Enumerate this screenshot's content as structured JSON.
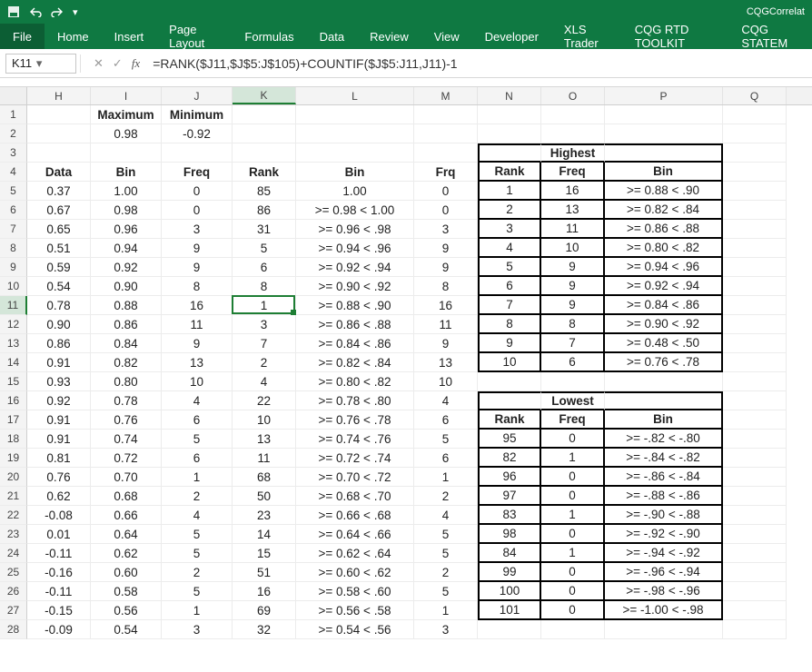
{
  "titlebar": {
    "doc_name": "CQGCorrelat"
  },
  "ribbon": {
    "tabs": [
      "File",
      "Home",
      "Insert",
      "Page Layout",
      "Formulas",
      "Data",
      "Review",
      "View",
      "Developer",
      "XLS Trader",
      "CQG RTD TOOLKIT",
      "CQG STATEM"
    ]
  },
  "namebox": "K11",
  "formula": "=RANK($J11,$J$5:J$105)+COUNTIF($J$5:J11,J11)-1",
  "columns": [
    "H",
    "I",
    "J",
    "K",
    "L",
    "M",
    "N",
    "O",
    "P",
    "Q"
  ],
  "headers": {
    "I1": "Maximum",
    "J1": "Minimum",
    "I2": "0.98",
    "J2": "-0.92",
    "H4": "Data",
    "I4": "Bin",
    "J4": "Freq",
    "K4": "Rank",
    "L4": "Bin",
    "M4": "Frq",
    "highest_title": "Highest",
    "N4": "Rank",
    "O4": "Freq",
    "P4": "Bin",
    "lowest_title": "Lowest",
    "N17": "Rank",
    "O17": "Freq",
    "P17": "Bin"
  },
  "main_rows": [
    {
      "r": 5,
      "H": "0.37",
      "I": "1.00",
      "J": "0",
      "K": "85",
      "L": "1.00",
      "M": "0"
    },
    {
      "r": 6,
      "H": "0.67",
      "I": "0.98",
      "J": "0",
      "K": "86",
      "L": ">= 0.98 < 1.00",
      "M": "0"
    },
    {
      "r": 7,
      "H": "0.65",
      "I": "0.96",
      "J": "3",
      "K": "31",
      "L": ">= 0.96 < .98",
      "M": "3"
    },
    {
      "r": 8,
      "H": "0.51",
      "I": "0.94",
      "J": "9",
      "K": "5",
      "L": ">= 0.94 < .96",
      "M": "9"
    },
    {
      "r": 9,
      "H": "0.59",
      "I": "0.92",
      "J": "9",
      "K": "6",
      "L": ">= 0.92 < .94",
      "M": "9"
    },
    {
      "r": 10,
      "H": "0.54",
      "I": "0.90",
      "J": "8",
      "K": "8",
      "L": ">= 0.90 < .92",
      "M": "8"
    },
    {
      "r": 11,
      "H": "0.78",
      "I": "0.88",
      "J": "16",
      "K": "1",
      "L": ">= 0.88 < .90",
      "M": "16"
    },
    {
      "r": 12,
      "H": "0.90",
      "I": "0.86",
      "J": "11",
      "K": "3",
      "L": ">= 0.86 < .88",
      "M": "11"
    },
    {
      "r": 13,
      "H": "0.86",
      "I": "0.84",
      "J": "9",
      "K": "7",
      "L": ">= 0.84 < .86",
      "M": "9"
    },
    {
      "r": 14,
      "H": "0.91",
      "I": "0.82",
      "J": "13",
      "K": "2",
      "L": ">= 0.82 < .84",
      "M": "13"
    },
    {
      "r": 15,
      "H": "0.93",
      "I": "0.80",
      "J": "10",
      "K": "4",
      "L": ">= 0.80 < .82",
      "M": "10"
    },
    {
      "r": 16,
      "H": "0.92",
      "I": "0.78",
      "J": "4",
      "K": "22",
      "L": ">= 0.78 < .80",
      "M": "4"
    },
    {
      "r": 17,
      "H": "0.91",
      "I": "0.76",
      "J": "6",
      "K": "10",
      "L": ">= 0.76 < .78",
      "M": "6"
    },
    {
      "r": 18,
      "H": "0.91",
      "I": "0.74",
      "J": "5",
      "K": "13",
      "L": ">= 0.74 < .76",
      "M": "5"
    },
    {
      "r": 19,
      "H": "0.81",
      "I": "0.72",
      "J": "6",
      "K": "11",
      "L": ">= 0.72 < .74",
      "M": "6"
    },
    {
      "r": 20,
      "H": "0.76",
      "I": "0.70",
      "J": "1",
      "K": "68",
      "L": ">= 0.70 < .72",
      "M": "1"
    },
    {
      "r": 21,
      "H": "0.62",
      "I": "0.68",
      "J": "2",
      "K": "50",
      "L": ">= 0.68 < .70",
      "M": "2"
    },
    {
      "r": 22,
      "H": "-0.08",
      "I": "0.66",
      "J": "4",
      "K": "23",
      "L": ">= 0.66 < .68",
      "M": "4"
    },
    {
      "r": 23,
      "H": "0.01",
      "I": "0.64",
      "J": "5",
      "K": "14",
      "L": ">= 0.64 < .66",
      "M": "5"
    },
    {
      "r": 24,
      "H": "-0.11",
      "I": "0.62",
      "J": "5",
      "K": "15",
      "L": ">= 0.62 < .64",
      "M": "5"
    },
    {
      "r": 25,
      "H": "-0.16",
      "I": "0.60",
      "J": "2",
      "K": "51",
      "L": ">= 0.60 < .62",
      "M": "2"
    },
    {
      "r": 26,
      "H": "-0.11",
      "I": "0.58",
      "J": "5",
      "K": "16",
      "L": ">= 0.58 < .60",
      "M": "5"
    },
    {
      "r": 27,
      "H": "-0.15",
      "I": "0.56",
      "J": "1",
      "K": "69",
      "L": ">= 0.56 < .58",
      "M": "1"
    },
    {
      "r": 28,
      "H": "-0.09",
      "I": "0.54",
      "J": "3",
      "K": "32",
      "L": ">= 0.54 < .56",
      "M": "3"
    }
  ],
  "highest": [
    {
      "r": 5,
      "N": "1",
      "O": "16",
      "P": ">= 0.88 < .90"
    },
    {
      "r": 6,
      "N": "2",
      "O": "13",
      "P": ">= 0.82 < .84"
    },
    {
      "r": 7,
      "N": "3",
      "O": "11",
      "P": ">= 0.86 < .88"
    },
    {
      "r": 8,
      "N": "4",
      "O": "10",
      "P": ">= 0.80 < .82"
    },
    {
      "r": 9,
      "N": "5",
      "O": "9",
      "P": ">= 0.94 < .96"
    },
    {
      "r": 10,
      "N": "6",
      "O": "9",
      "P": ">= 0.92 < .94"
    },
    {
      "r": 11,
      "N": "7",
      "O": "9",
      "P": ">= 0.84 < .86"
    },
    {
      "r": 12,
      "N": "8",
      "O": "8",
      "P": ">= 0.90 < .92"
    },
    {
      "r": 13,
      "N": "9",
      "O": "7",
      "P": ">= 0.48 < .50"
    },
    {
      "r": 14,
      "N": "10",
      "O": "6",
      "P": ">= 0.76 < .78"
    }
  ],
  "lowest": [
    {
      "r": 18,
      "N": "95",
      "O": "0",
      "P": ">= -.82 < -.80"
    },
    {
      "r": 19,
      "N": "82",
      "O": "1",
      "P": ">= -.84 < -.82"
    },
    {
      "r": 20,
      "N": "96",
      "O": "0",
      "P": ">= -.86 < -.84"
    },
    {
      "r": 21,
      "N": "97",
      "O": "0",
      "P": ">= -.88 < -.86"
    },
    {
      "r": 22,
      "N": "83",
      "O": "1",
      "P": ">= -.90 < -.88"
    },
    {
      "r": 23,
      "N": "98",
      "O": "0",
      "P": ">= -.92 < -.90"
    },
    {
      "r": 24,
      "N": "84",
      "O": "1",
      "P": ">= -.94 < -.92"
    },
    {
      "r": 25,
      "N": "99",
      "O": "0",
      "P": ">= -.96 < -.94"
    },
    {
      "r": 26,
      "N": "100",
      "O": "0",
      "P": ">= -.98 < -.96"
    },
    {
      "r": 27,
      "N": "101",
      "O": "0",
      "P": ">= -1.00 < -.98"
    }
  ],
  "active_cell": {
    "row": 11,
    "col": "K"
  }
}
